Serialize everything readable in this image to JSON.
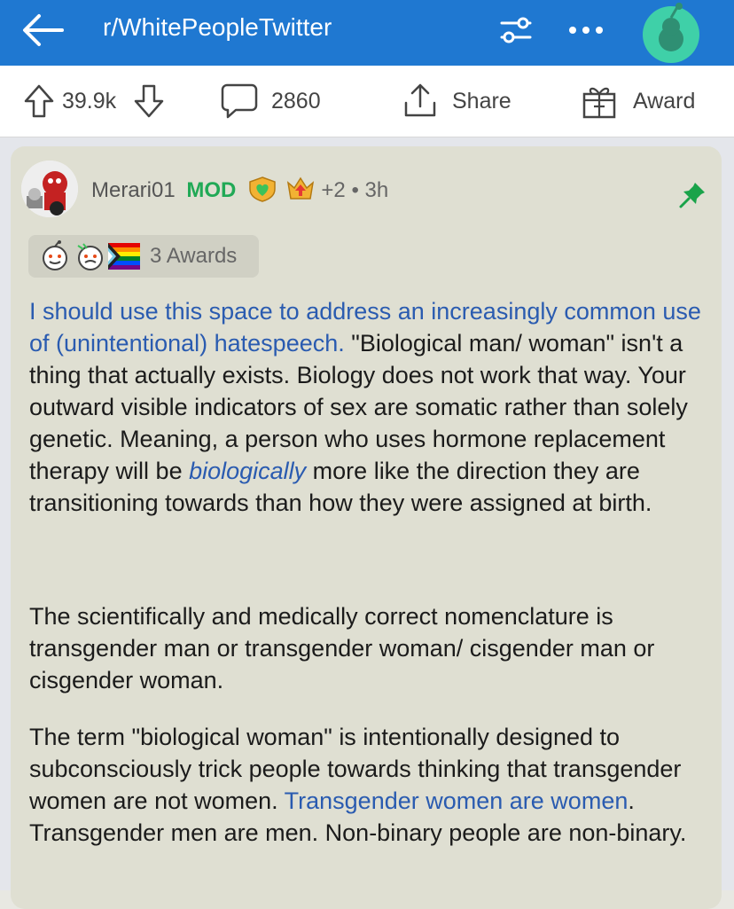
{
  "header": {
    "subreddit": "r/WhitePeopleTwitter",
    "bg_color": "#1f78d1",
    "icons": [
      "back-arrow-icon",
      "filter-sliders-icon",
      "more-dots-icon",
      "snoo-avatar-icon"
    ]
  },
  "action_bar": {
    "upvotes": "39.9k",
    "comments": "2860",
    "share_label": "Share",
    "award_label": "Award"
  },
  "comment": {
    "username": "Merari01",
    "mod_label": "MOD",
    "extra_awards": "+2",
    "separator": "•",
    "time": "3h",
    "awards_label": "3 Awards",
    "pinned": true,
    "mod_color": "#21a956",
    "link_color": "#2a5bb0",
    "p1": {
      "link": "I should use this space to address an increasingly common use of (unintentional) hatespeech.",
      "text_a": "  \"Biological man/ woman\" isn't a thing that actually exists. Biology does not work that way. Your outward visible indicators of sex are somatic  rather than solely genetic. Meaning, a person who uses hormone replacement therapy will be ",
      "em": "biologically",
      "text_b": " more like the direction they are transitioning towards than how they were assigned at birth."
    },
    "p2": "The scientifically and medically correct nomenclature is transgender man or transgender woman/ cisgender man or cisgender woman.",
    "p3": {
      "text_a": "The term \"biological woman\" is intentionally designed to subconsciously trick people towards thinking that transgender women are not women. ",
      "link": "Transgender women are women",
      "text_b": ". Transgender men are men. Non-binary people are non-binary."
    }
  }
}
